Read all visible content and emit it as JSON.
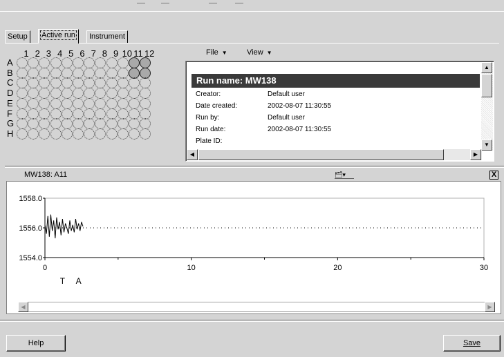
{
  "tabs": [
    {
      "label": "Setup",
      "active": false
    },
    {
      "label": "Active run",
      "active": true
    },
    {
      "label": "Instrument",
      "active": false
    }
  ],
  "plate": {
    "columns": [
      "1",
      "2",
      "3",
      "4",
      "5",
      "6",
      "7",
      "8",
      "9",
      "10",
      "11",
      "12"
    ],
    "rows": [
      "A",
      "B",
      "C",
      "D",
      "E",
      "F",
      "G",
      "H"
    ],
    "filled_wells": [
      "A11",
      "A12",
      "B11",
      "B12"
    ]
  },
  "menu": {
    "file": "File",
    "view": "View"
  },
  "run_info": {
    "run_name": "Run name: MW138",
    "fields": [
      {
        "label": "Creator:",
        "value": "Default user"
      },
      {
        "label": "Date created:",
        "value": "2002-08-07 11:30:55"
      },
      {
        "label": "Run by:",
        "value": "Default user"
      },
      {
        "label": "Run date:",
        "value": "2002-08-07 11:30:55"
      },
      {
        "label": "Plate ID:",
        "value": ""
      }
    ]
  },
  "panel": {
    "title": "MW138: A11",
    "close": "X"
  },
  "markers": [
    "T",
    "A"
  ],
  "chart_data": {
    "type": "line",
    "title": "",
    "xlabel": "",
    "ylabel": "",
    "xlim": [
      0,
      30
    ],
    "ylim": [
      1554.0,
      1558.0
    ],
    "x_ticks": [
      "0",
      "10",
      "20",
      "30"
    ],
    "y_ticks": [
      "1554.0",
      "1556.0",
      "1558.0"
    ],
    "baseline": 1556.0,
    "series": [
      {
        "x": [
          0.0,
          0.1,
          0.2,
          0.3,
          0.4,
          0.5,
          0.6,
          0.7,
          0.8,
          0.9,
          1.0,
          1.1,
          1.2,
          1.3,
          1.4,
          1.5,
          1.6,
          1.7,
          1.8,
          1.9,
          2.0,
          2.1,
          2.2,
          2.3,
          2.4,
          2.5,
          2.6
        ],
        "y": [
          1556.2,
          1555.6,
          1556.8,
          1555.4,
          1556.9,
          1555.8,
          1556.5,
          1555.3,
          1556.7,
          1555.9,
          1556.4,
          1555.5,
          1556.6,
          1555.7,
          1556.3,
          1556.0,
          1555.6,
          1556.5,
          1555.8,
          1556.2,
          1555.7,
          1556.6,
          1555.9,
          1556.3,
          1555.8,
          1556.4,
          1556.1
        ]
      }
    ]
  },
  "buttons": {
    "help": "Help",
    "save": "Save"
  }
}
